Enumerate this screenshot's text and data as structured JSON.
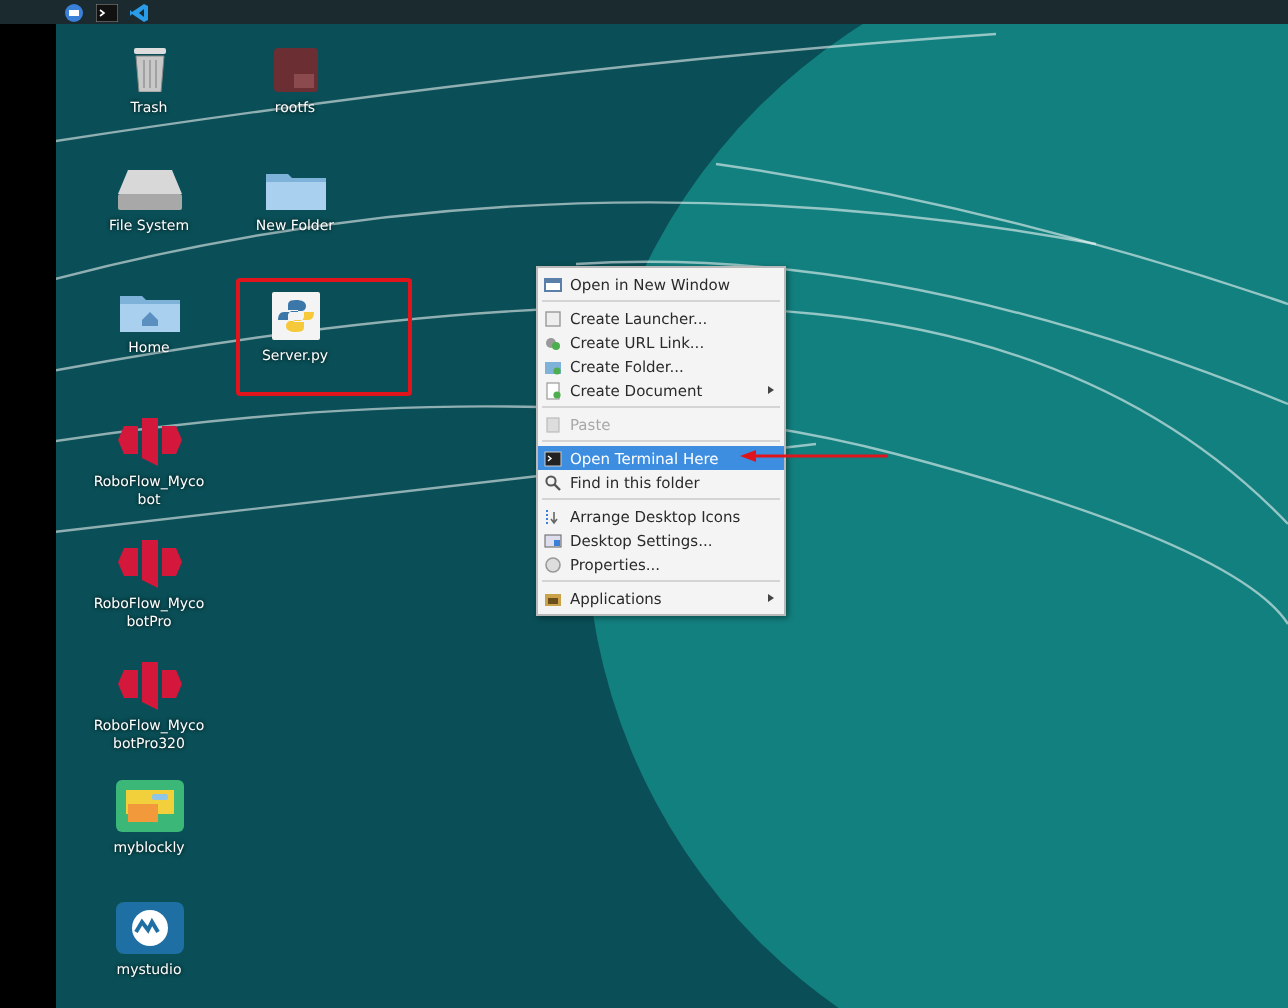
{
  "desktop": {
    "columns": [
      [
        {
          "label": "Trash",
          "annotated": false
        },
        {
          "label": "File System",
          "annotated": false
        },
        {
          "label": "Home",
          "annotated": false
        },
        {
          "label": "RoboFlow_Mycobot",
          "annotated": false
        },
        {
          "label": "RoboFlow_MycobotPro",
          "annotated": false
        },
        {
          "label": "RoboFlow_MycobotPro320",
          "annotated": false
        },
        {
          "label": "myblockly",
          "annotated": false
        },
        {
          "label": "mystudio",
          "annotated": false
        }
      ],
      [
        {
          "label": "rootfs",
          "annotated": false
        },
        {
          "label": "New Folder",
          "annotated": false
        },
        {
          "label": "Server.py",
          "annotated": true
        }
      ]
    ]
  },
  "context_menu": {
    "items": [
      {
        "kind": "item",
        "label": "Open in New Window",
        "disabled": false,
        "selected": false,
        "submenu": false
      },
      {
        "kind": "separator"
      },
      {
        "kind": "item",
        "label": "Create Launcher...",
        "disabled": false,
        "selected": false,
        "submenu": false
      },
      {
        "kind": "item",
        "label": "Create URL Link...",
        "disabled": false,
        "selected": false,
        "submenu": false
      },
      {
        "kind": "item",
        "label": "Create Folder...",
        "disabled": false,
        "selected": false,
        "submenu": false
      },
      {
        "kind": "item",
        "label": "Create Document",
        "disabled": false,
        "selected": false,
        "submenu": true
      },
      {
        "kind": "separator"
      },
      {
        "kind": "item",
        "label": "Paste",
        "disabled": true,
        "selected": false,
        "submenu": false
      },
      {
        "kind": "separator"
      },
      {
        "kind": "item",
        "label": "Open Terminal Here",
        "disabled": false,
        "selected": true,
        "submenu": false,
        "annotated": true
      },
      {
        "kind": "item",
        "label": "Find in this folder",
        "disabled": false,
        "selected": false,
        "submenu": false
      },
      {
        "kind": "separator"
      },
      {
        "kind": "item",
        "label": "Arrange Desktop Icons",
        "disabled": false,
        "selected": false,
        "submenu": false
      },
      {
        "kind": "item",
        "label": "Desktop Settings...",
        "disabled": false,
        "selected": false,
        "submenu": false
      },
      {
        "kind": "item",
        "label": "Properties...",
        "disabled": false,
        "selected": false,
        "submenu": false
      },
      {
        "kind": "separator"
      },
      {
        "kind": "item",
        "label": "Applications",
        "disabled": false,
        "selected": false,
        "submenu": true
      }
    ]
  }
}
